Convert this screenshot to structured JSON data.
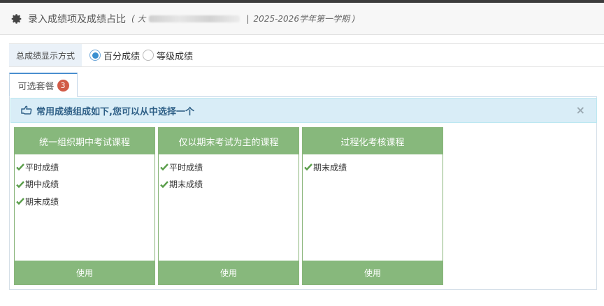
{
  "header": {
    "title": "录入成绩项及成绩占比",
    "subtitle_open": "( 大",
    "subtitle_sep": "|",
    "term": "2025-2026学年第一学期 )"
  },
  "display_mode": {
    "label": "总成绩显示方式",
    "options": [
      "百分成绩",
      "等级成绩"
    ],
    "selected": "百分成绩"
  },
  "tabs": [
    {
      "label": "可选套餐",
      "badge": "3"
    }
  ],
  "alert": {
    "text": "常用成绩组成如下,您可以从中选择一个",
    "close": "×"
  },
  "plans": [
    {
      "title": "统一组织期中考试课程",
      "items": [
        "平时成绩",
        "期中成绩",
        "期末成绩"
      ],
      "button": "使用"
    },
    {
      "title": "仅以期末考试为主的课程",
      "items": [
        "平时成绩",
        "期末成绩"
      ],
      "button": "使用"
    },
    {
      "title": "过程化考核课程",
      "items": [
        "期末成绩"
      ],
      "button": "使用"
    }
  ],
  "colors": {
    "card_green": "#87b87c",
    "alert_bg": "#d9edf7",
    "badge_red": "#d15b47",
    "radio_blue": "#3a8fd0"
  }
}
